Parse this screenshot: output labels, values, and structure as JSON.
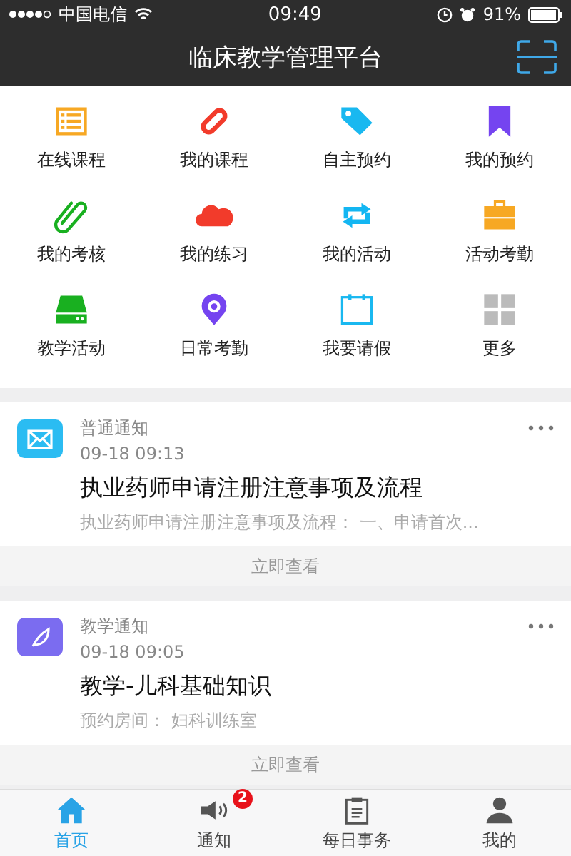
{
  "status_bar": {
    "carrier": "中国电信",
    "time": "09:49",
    "battery": "91%"
  },
  "header": {
    "title": "临床教学管理平台"
  },
  "shortcuts": [
    {
      "label": "在线课程"
    },
    {
      "label": "我的课程"
    },
    {
      "label": "自主预约"
    },
    {
      "label": "我的预约"
    },
    {
      "label": "我的考核"
    },
    {
      "label": "我的练习"
    },
    {
      "label": "我的活动"
    },
    {
      "label": "活动考勤"
    },
    {
      "label": "教学活动"
    },
    {
      "label": "日常考勤"
    },
    {
      "label": "我要请假"
    },
    {
      "label": "更多"
    }
  ],
  "notices": [
    {
      "type": "普通通知",
      "color": "#2bbcf2",
      "time": "09-18 09:13",
      "title": "执业药师申请注册注意事项及流程",
      "summary": "执业药师申请注册注意事项及流程：  一、申请首次...",
      "action": "立即查看"
    },
    {
      "type": "教学通知",
      "color": "#7b6cf0",
      "time": "09-18 09:05",
      "title": "教学-儿科基础知识",
      "summary": "预约房间：  妇科训练室",
      "action": "立即查看"
    }
  ],
  "tab_bar": [
    {
      "label": "首页",
      "selected": true
    },
    {
      "label": "通知",
      "selected": false,
      "badge": "2"
    },
    {
      "label": "每日事务",
      "selected": false
    },
    {
      "label": "我的",
      "selected": false
    }
  ]
}
